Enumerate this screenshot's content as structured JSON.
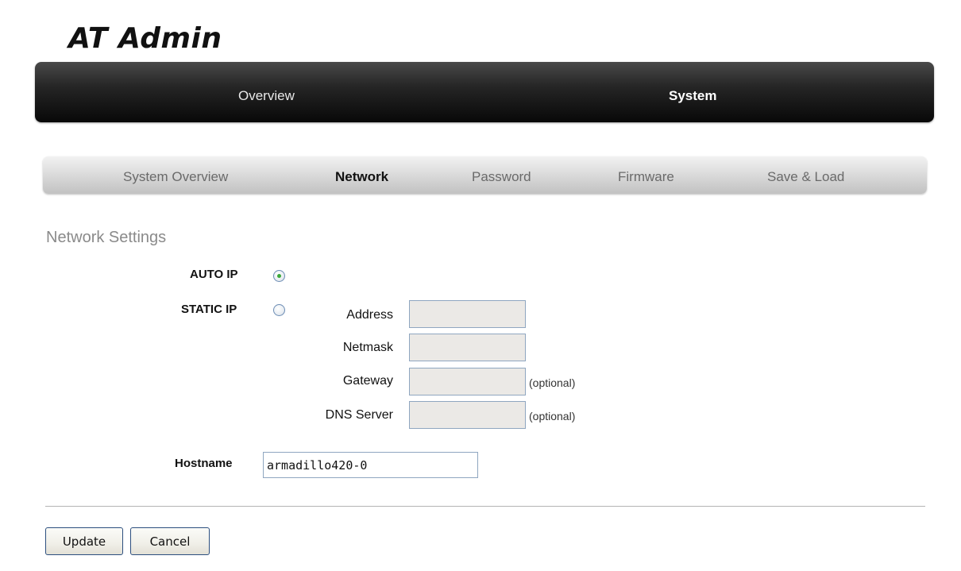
{
  "app": {
    "logo_text": "AT Admin"
  },
  "main_nav": {
    "tabs": [
      {
        "label": "Overview",
        "active": false
      },
      {
        "label": "System",
        "active": true
      }
    ]
  },
  "sub_nav": {
    "tabs": [
      {
        "label": "System Overview",
        "active": false
      },
      {
        "label": "Network",
        "active": true
      },
      {
        "label": "Password",
        "active": false
      },
      {
        "label": "Firmware",
        "active": false
      },
      {
        "label": "Save & Load",
        "active": false
      }
    ]
  },
  "network_settings": {
    "title": "Network Settings",
    "auto_ip_label": "AUTO IP",
    "static_ip_label": "STATIC IP",
    "selected_mode": "auto",
    "fields": {
      "address": {
        "label": "Address",
        "value": ""
      },
      "netmask": {
        "label": "Netmask",
        "value": ""
      },
      "gateway": {
        "label": "Gateway",
        "value": "",
        "note": "(optional)"
      },
      "dns_server": {
        "label": "DNS Server",
        "value": "",
        "note": "(optional)"
      }
    },
    "hostname": {
      "label": "Hostname",
      "value": "armadillo420-0"
    }
  },
  "actions": {
    "update_label": "Update",
    "cancel_label": "Cancel"
  },
  "colors": {
    "radio_selected_dot": "#3aa83a",
    "field_border": "#8fa6c0",
    "disabled_field_bg": "#ebe9e6"
  }
}
